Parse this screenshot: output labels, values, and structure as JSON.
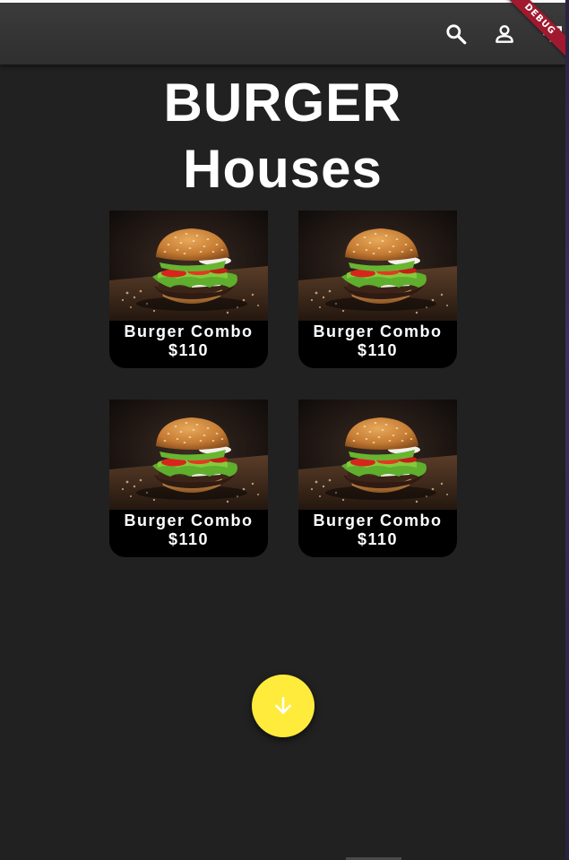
{
  "app": {
    "title_line1": "BURGER",
    "title_line2": "Houses",
    "debug_banner": "DEBUG"
  },
  "appbar": {
    "icons": [
      "search-icon",
      "account-icon",
      "cast-icon"
    ]
  },
  "products": [
    {
      "name": "Burger Combo",
      "price": "$110"
    },
    {
      "name": "Burger Combo",
      "price": "$110"
    },
    {
      "name": "Burger Combo",
      "price": "$110"
    },
    {
      "name": "Burger Combo",
      "price": "$110"
    }
  ],
  "fab": {
    "icon": "arrow-down-icon"
  },
  "colors": {
    "background": "#212121",
    "appbar": "#333333",
    "card": "#000000",
    "fab": "#ffeb3b",
    "debug_banner": "#a0192e"
  }
}
